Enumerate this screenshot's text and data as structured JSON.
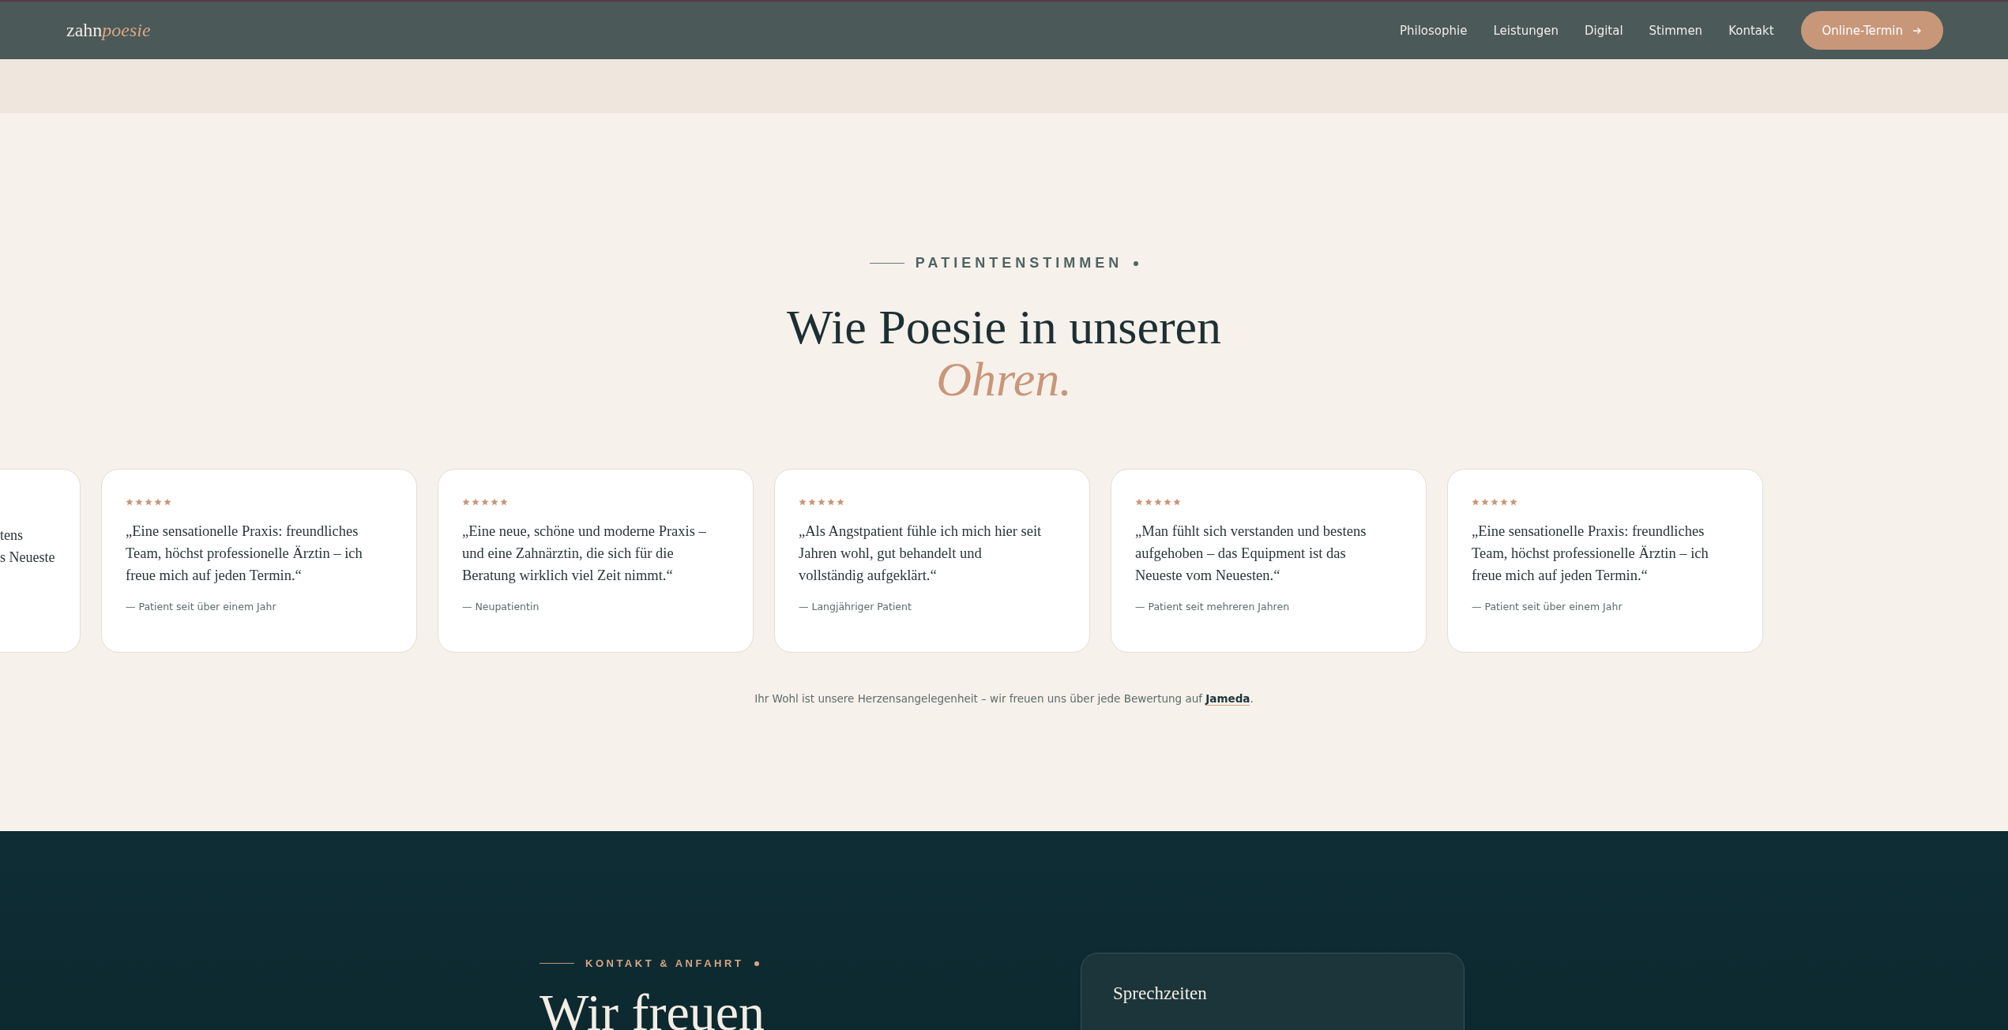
{
  "nav": {
    "logo": {
      "text": "zahn",
      "accent": "poesie"
    },
    "links": [
      "Philosophie",
      "Leistungen",
      "Digital",
      "Stimmen",
      "Kontakt"
    ],
    "cta": "Online-Termin"
  },
  "testimonials": {
    "eyebrow": "PATIENTENSTIMMEN",
    "title": "Wie Poesie in unseren",
    "title_accent": "Ohren.",
    "cards": [
      {
        "kind": "partial",
        "lines": [
          "tens",
          "s Neueste"
        ]
      },
      {
        "kind": "full",
        "stars": 5,
        "quote": "„Eine sensationelle Praxis: freundliches Team, höchst professionelle Ärztin – ich freue mich auf jeden Termin.“",
        "author": "— Patient seit über einem Jahr"
      },
      {
        "kind": "full",
        "stars": 5,
        "quote": "„Eine neue, schöne und moderne Praxis – und eine Zahnärztin, die sich für die Beratung wirklich viel Zeit nimmt.“",
        "author": "— Neupatientin"
      },
      {
        "kind": "full",
        "stars": 5,
        "quote": "„Als Angstpatient fühle ich mich hier seit Jahren wohl, gut behandelt und vollständig aufgeklärt.“",
        "author": "— Langjähriger Patient"
      },
      {
        "kind": "full",
        "stars": 5,
        "quote": "„Man fühlt sich verstanden und bestens aufgehoben – das Equipment ist das Neueste vom Neuesten.“",
        "author": "— Patient seit mehreren Jahren"
      },
      {
        "kind": "full",
        "stars": 5,
        "quote": "„Eine sensationelle Praxis: freundliches Team, höchst professionelle Ärztin – ich freue mich auf jeden Termin.“",
        "author": "— Patient seit über einem Jahr"
      }
    ],
    "note": "Ihr Wohl ist unsere Herzensangelegenheit – wir freuen uns über jede Bewertung auf",
    "note_link": "Jameda",
    "note_end": "."
  },
  "contact": {
    "eyebrow": "KONTAKT & ANFAHRT",
    "title": "Wir freuen",
    "card_title": "Sprechzeiten"
  }
}
